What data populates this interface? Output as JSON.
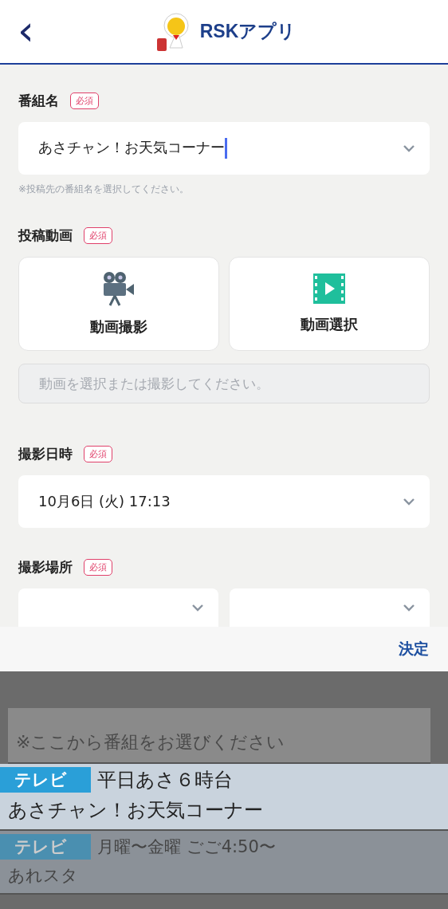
{
  "header": {
    "back": "‹",
    "title": "RSKアプリ"
  },
  "sections": [
    {
      "kind": "select",
      "label": "番組名",
      "badge": "必須",
      "value": "あさチャン！お天気コーナー",
      "focused": true,
      "hint": "※投稿先の番組名を選択してください。"
    },
    {
      "kind": "media",
      "label": "投稿動画",
      "badge": "必須",
      "buttons": [
        {
          "label": "動画撮影"
        },
        {
          "label": "動画選択"
        }
      ],
      "placeholder": "動画を選択または撮影してください。"
    },
    {
      "kind": "select",
      "label": "撮影日時",
      "badge": "必須",
      "value": "10月6日 (火) 17:13"
    },
    {
      "kind": "split",
      "label": "撮影場所",
      "badge": "必須",
      "selects": [
        {
          "kind": "select"
        },
        {
          "kind": "select"
        }
      ]
    }
  ],
  "picker": {
    "done": "決定",
    "items": [
      {
        "kind": "hint",
        "text": "※ここから番組をお選びください"
      },
      {
        "kind": "program",
        "tag": "テレビ",
        "time": "平日あさ６時台",
        "title": "あさチャン！お天気コーナー",
        "selected": true
      },
      {
        "kind": "program",
        "tag": "テレビ",
        "time": "月曜〜金曜 ごご4:50〜",
        "title": "あれスタ",
        "selected": false
      }
    ]
  }
}
